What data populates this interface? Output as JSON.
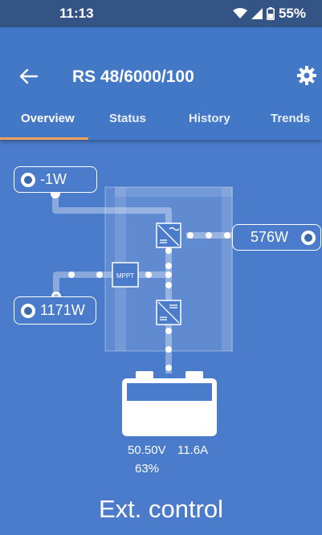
{
  "status_bar": {
    "time": "11:13",
    "battery_pct": "55%",
    "icons": [
      "wifi-icon",
      "signal-icon",
      "battery-icon"
    ]
  },
  "app_bar": {
    "title": "RS 48/6000/100",
    "back_icon": "arrow-left-icon",
    "settings_icon": "gear-icon"
  },
  "tabs": [
    {
      "label": "Overview",
      "active": true
    },
    {
      "label": "Status",
      "active": false
    },
    {
      "label": "History",
      "active": false
    },
    {
      "label": "Trends",
      "active": false
    }
  ],
  "diagram": {
    "grid_input": {
      "value": "-1W",
      "icon": "ac-input-icon"
    },
    "solar_input": {
      "value": "1171W",
      "icon": "solar-icon"
    },
    "ac_output": {
      "value": "576W",
      "icon": "lightbulb-icon"
    },
    "mppt_label": "MPPT",
    "battery": {
      "voltage": "50.50V",
      "current": "11.6A",
      "soc": "63%",
      "fill": 0.63
    }
  },
  "mode_text": "Ext. control",
  "colors": {
    "background": "#4a7ccb",
    "appbar": "#4378c7",
    "statusbar": "#345486",
    "accent": "#f0a05a"
  }
}
